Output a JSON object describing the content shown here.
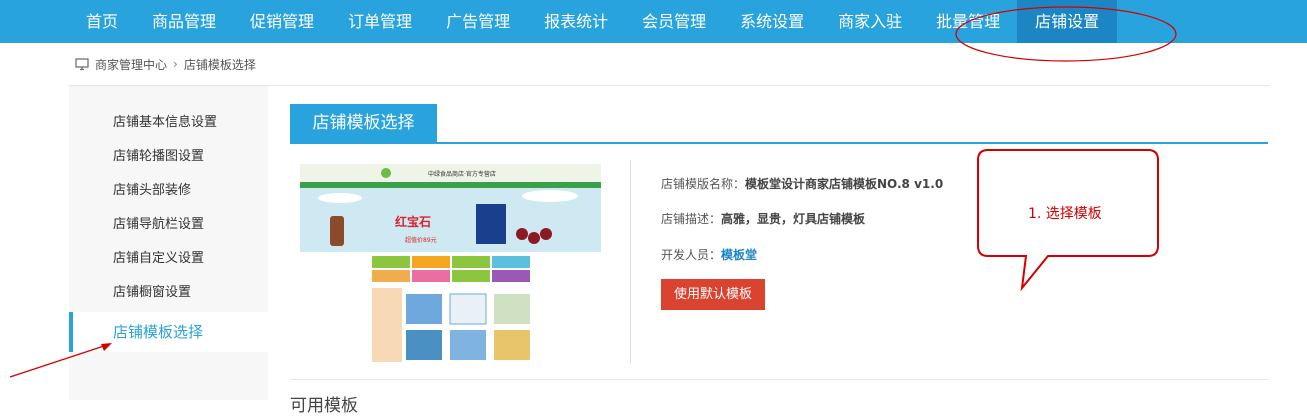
{
  "topnav": {
    "items": [
      "首页",
      "商品管理",
      "促销管理",
      "订单管理",
      "广告管理",
      "报表统计",
      "会员管理",
      "系统设置",
      "商家入驻",
      "批量管理",
      "店铺设置"
    ],
    "active_index": 10
  },
  "breadcrumb": {
    "root": "商家管理中心",
    "separator": "›",
    "current": "店铺模板选择"
  },
  "sidebar": {
    "items": [
      "店铺基本信息设置",
      "店铺轮播图设置",
      "店铺头部装修",
      "店铺导航栏设置",
      "店铺自定义设置",
      "店铺橱窗设置",
      "店铺模板选择"
    ],
    "active_index": 6
  },
  "main": {
    "tab_label": "店铺模板选择",
    "template": {
      "name_label": "店铺模版名称：",
      "name_value": "模板堂设计商家店铺模板NO.8 v1.0",
      "desc_label": "店铺描述：",
      "desc_value": "高雅，显贵，灯具店铺模板",
      "dev_label": "开发人员：",
      "dev_value": "模板堂"
    },
    "default_button": "使用默认模板",
    "section_title": "可用模板"
  },
  "thumbnail": {
    "banner_title": "中绿食品商店·官方专营店",
    "promo_text": "红宝石",
    "price_text": "超值价89元"
  },
  "annotation": {
    "bubble_label": "1. 选择模板"
  },
  "colors": {
    "brand_blue": "#29a3dd",
    "active_blue": "#1b86c3",
    "button_red": "#d9432f",
    "annotation_red": "#d40000"
  }
}
